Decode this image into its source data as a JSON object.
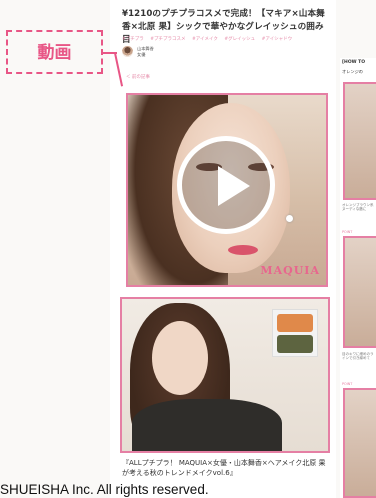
{
  "article": {
    "title": "¥1210のプチプラコスメで完成！【マキア×山本舞香×北原 果】シックで華やかなグレイッシュの囲み目",
    "tags": [
      "#プチプラ",
      "#プチプラコスメ",
      "#アイメイク",
      "#グレイッシュ",
      "#アイシャドウ"
    ],
    "author_name": "山本舞香",
    "author_role": "女優",
    "back_link": "＜ 前の記事",
    "hero_logo": "MAQUIA"
  },
  "annotation": {
    "label": "動画"
  },
  "related": {
    "caption": "『ALLプチプラ！ MAQUIA×女優・山本舞香×ヘアメイク北原 果が考える秋のトレンドメイクvol.6』"
  },
  "sidebar": {
    "heading": "[HOW TO",
    "subheading": "オレンジの",
    "note_a": "オレンジブラウン系ヌーディな唇に",
    "mark_a": "POINT",
    "note_b": "目のキワに細めのラインで引き締めて",
    "mark_b": "POINT"
  },
  "footer": {
    "copyright": "SHUEISHA Inc. All rights reserved."
  },
  "colors": {
    "accent_pink": "#e85686",
    "frame_pink": "#e57fa4",
    "palette_orange": "#e0894a",
    "palette_olive": "#5d6440"
  }
}
